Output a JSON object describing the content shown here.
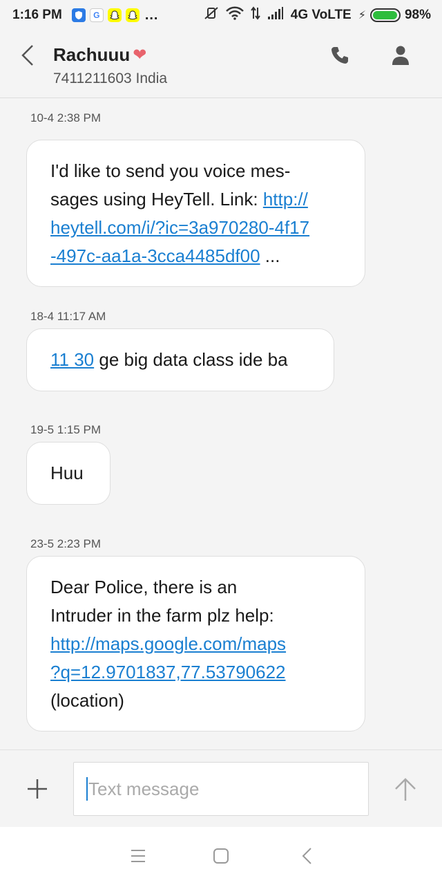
{
  "status_bar": {
    "time": "1:16 PM",
    "notification_icons": [
      "shield-icon",
      "google-icon",
      "snapchat-icon",
      "snapchat-icon"
    ],
    "more": "...",
    "network": "4G VoLTE",
    "battery": "98%",
    "battery_level": 0.98,
    "battery_color": "#2ebd3d"
  },
  "header": {
    "contact_name": "Rachuuu",
    "contact_emoji": "❤",
    "contact_number": "7411211603 India"
  },
  "messages": [
    {
      "timestamp": "10-4 2:38 PM",
      "lines": [
        [
          {
            "t": "I'd like to send you voice mes-",
            "link": false
          }
        ],
        [
          {
            "t": "sages using HeyTell. Link: ",
            "link": false
          },
          {
            "t": "http://",
            "link": true
          }
        ],
        [
          {
            "t": "heytell.com/i/?ic=3a970280-4f17",
            "link": true
          }
        ],
        [
          {
            "t": "-497c-aa1a-3cca4485df00",
            "link": true
          },
          {
            "t": " ...",
            "link": false
          }
        ]
      ]
    },
    {
      "timestamp": "18-4 11:17 AM",
      "lines": [
        [
          {
            "t": "11 30",
            "link": true
          },
          {
            "t": " ge big data class ide ba",
            "link": false
          }
        ]
      ]
    },
    {
      "timestamp": "19-5 1:15 PM",
      "lines": [
        [
          {
            "t": "Huu",
            "link": false
          }
        ]
      ]
    },
    {
      "timestamp": "23-5 2:23 PM",
      "lines": [
        [
          {
            "t": "Dear Police, there is an",
            "link": false
          }
        ],
        [
          {
            "t": "Intruder in the farm plz help:",
            "link": false
          }
        ],
        [
          {
            "t": "http://maps.google.com/maps",
            "link": true
          }
        ],
        [
          {
            "t": "?q=12.9701837,77.53790622",
            "link": true
          }
        ],
        [
          {
            "t": "(location)",
            "link": false
          }
        ]
      ]
    }
  ],
  "compose": {
    "placeholder": "Text message"
  },
  "colors": {
    "link": "#1a7fd1",
    "heart": "#e8636c"
  }
}
